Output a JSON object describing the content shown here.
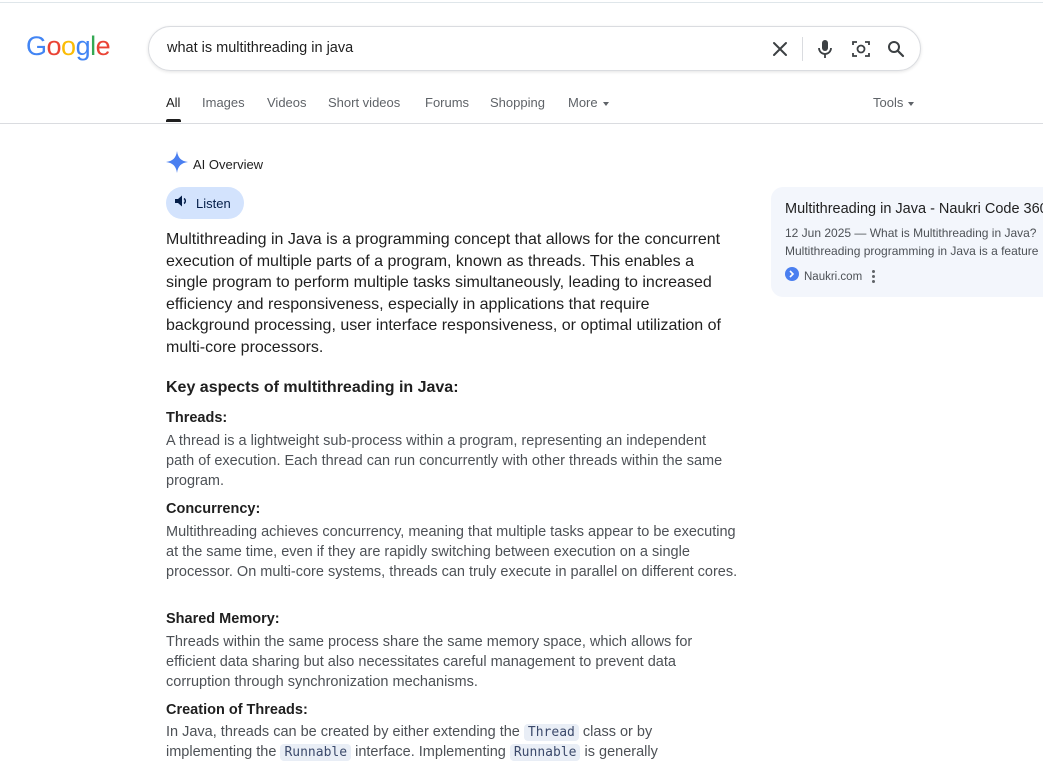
{
  "logo": {
    "letters": [
      {
        "char": "G",
        "color": "#4285F4"
      },
      {
        "char": "o",
        "color": "#EA4335"
      },
      {
        "char": "o",
        "color": "#FBBC05"
      },
      {
        "char": "g",
        "color": "#4285F4"
      },
      {
        "char": "l",
        "color": "#34A853"
      },
      {
        "char": "e",
        "color": "#EA4335"
      }
    ]
  },
  "search": {
    "query": "what is multithreading in java",
    "icons": [
      "close-icon",
      "mic-icon",
      "lens-icon",
      "search-icon"
    ]
  },
  "tabs": [
    {
      "label": "All",
      "active": true
    },
    {
      "label": "Images"
    },
    {
      "label": "Videos"
    },
    {
      "label": "Short videos"
    },
    {
      "label": "Forums"
    },
    {
      "label": "Shopping"
    },
    {
      "label": "More"
    }
  ],
  "tools_label": "Tools",
  "ai_overview": {
    "title": "AI Overview",
    "listen_label": "Listen",
    "summary": "Multithreading in Java is a programming concept that allows for the concurrent execution of multiple parts of a program, known as threads. This enables a single program to perform multiple tasks simultaneously, leading to increased efficiency and responsiveness, especially in applications that require background processing, user interface responsiveness, or optimal utilization of multi-core processors.",
    "key_heading": "Key aspects of multithreading in Java:",
    "sections": [
      {
        "title": "Threads:",
        "body": "A thread is a lightweight sub-process within a program, representing an independent path of execution. Each thread can run concurrently with other threads within the same program."
      },
      {
        "title": "Concurrency:",
        "body": "Multithreading achieves concurrency, meaning that multiple tasks appear to be executing at the same time, even if they are rapidly switching between execution on a single processor. On multi-core systems, threads can truly execute in parallel on different cores."
      },
      {
        "title": "Shared Memory:",
        "body": "Threads within the same process share the same memory space, which allows for efficient data sharing but also necessitates careful management to prevent data corruption through synchronization mechanisms."
      },
      {
        "title": "Creation of Threads:",
        "body_parts": [
          "In Java, threads can be created by either extending the ",
          "Thread",
          " class or by implementing the ",
          "Runnable",
          " interface. Implementing ",
          "Runnable",
          " is generally"
        ]
      }
    ],
    "accent_color": "#d3e3fd"
  },
  "source_card": {
    "title": "Multithreading in Java - Naukri Code 360",
    "snippet_line1": "12 Jun 2025 — What is Multithreading in Java?",
    "snippet_line2": "Multithreading programming in Java is a feature",
    "site": "Naukri.com"
  }
}
